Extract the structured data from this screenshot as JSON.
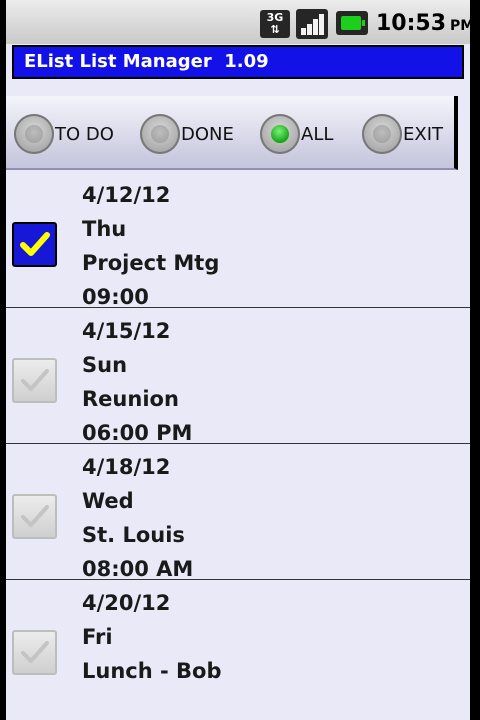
{
  "status_bar": {
    "network": "3G",
    "time": "10:53",
    "ampm": "PM",
    "icons": [
      "network-3g-icon",
      "signal-icon",
      "battery-icon"
    ]
  },
  "app": {
    "title": "EList List Manager  1.09"
  },
  "filters": [
    {
      "label": "TO DO",
      "selected": false
    },
    {
      "label": "DONE",
      "selected": false
    },
    {
      "label": "ALL",
      "selected": true
    },
    {
      "label": "EXIT",
      "selected": false
    }
  ],
  "items": [
    {
      "checked": true,
      "date": "4/12/12",
      "day": "Thu",
      "title": "Project Mtg",
      "time": "09:00"
    },
    {
      "checked": false,
      "date": "4/15/12",
      "day": "Sun",
      "title": "Reunion",
      "time": "06:00 PM"
    },
    {
      "checked": false,
      "date": "4/18/12",
      "day": "Wed",
      "title": "St. Louis",
      "time": "08:00 AM"
    },
    {
      "checked": false,
      "date": "4/20/12",
      "day": "Fri",
      "title": "Lunch - Bob",
      "time": ""
    }
  ],
  "colors": {
    "title_bar": "#1212e8",
    "check_checked": "#1717d8",
    "checkmark": "#ffff00",
    "list_bg": "#e9e9f8",
    "radio_on": "#0ca20c"
  }
}
